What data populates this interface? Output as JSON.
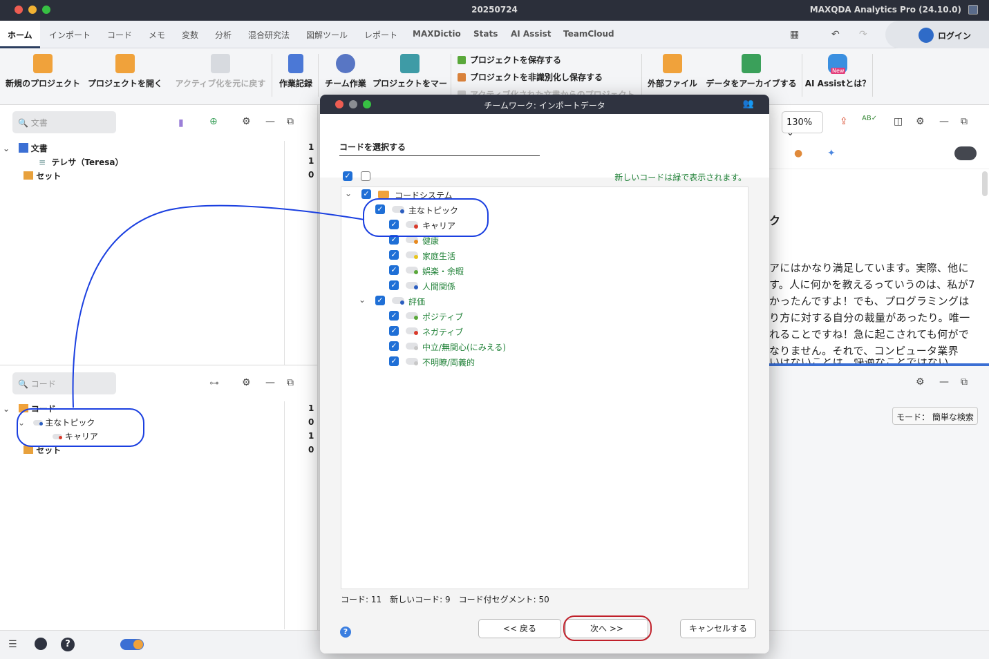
{
  "window": {
    "title": "20250724",
    "app_name": "MAXQDA Analytics Pro (24.10.0)"
  },
  "menu_tabs": [
    "ホーム",
    "インポート",
    "コード",
    "メモ",
    "変数",
    "分析",
    "混合研究法",
    "図解ツール",
    "レポート",
    "MAXDictio",
    "Stats",
    "AI Assist",
    "TeamCloud"
  ],
  "login_label": "ログイン",
  "ribbon": {
    "new_project": "新規のプロジェクト",
    "open_project": "プロジェクトを開く",
    "undo_activation": "アクティブ化を元に戻す",
    "work_log": "作業記録",
    "teamwork": "チーム作業",
    "merge_project": "プロジェクトをマー",
    "save_project": "プロジェクトを保存する",
    "save_anonymized": "プロジェクトを非識別化し保存する",
    "export_activated": "アクティブ化された文書からのプロジェクト",
    "external_files": "外部ファイル",
    "archive_data": "データをアーカイブする",
    "ai_assist": "AI Assistとは？",
    "new_badge": "New"
  },
  "doc_panel": {
    "search_placeholder": "文書",
    "rows": [
      {
        "label": "文書",
        "count": "1"
      },
      {
        "label": "テレサ（Teresa）",
        "count": "1"
      },
      {
        "label": "セット",
        "count": "0"
      }
    ]
  },
  "code_panel": {
    "search_placeholder": "コード",
    "rows": [
      {
        "label": "コード",
        "count": "1"
      },
      {
        "label": "主なトピック",
        "count": "0"
      },
      {
        "label": "キャリア",
        "count": "1"
      },
      {
        "label": "セット",
        "count": "0"
      }
    ]
  },
  "right_panel": {
    "zoom": "130%",
    "heading_fragment": "ク",
    "text_lines": [
      "アにはかなり満足しています。実際、他に",
      "す。人に何かを教えるっていうのは、私が7",
      "かったんですよ！でも、プログラミングは",
      "り方に対する自分の裁量があったり。唯一",
      "れることですね！急に起こされても何がで",
      "なりません。それで、コンピュータ業界",
      "いけないことは、快適なことではない"
    ],
    "mode_label": "モード： 簡単な検索"
  },
  "dialog": {
    "title": "チームワーク: インポートデータ",
    "section_title": "コードを選択する",
    "info_green": "新しいコードは緑で表示されます。",
    "tree": [
      {
        "label": "コードシステム",
        "level": 0,
        "green": false,
        "dot": ""
      },
      {
        "label": "主なトピック",
        "level": 1,
        "green": false,
        "dot": "#2b5ec0"
      },
      {
        "label": "キャリア",
        "level": 2,
        "green": false,
        "dot": "#d93a2b"
      },
      {
        "label": "健康",
        "level": 2,
        "green": true,
        "dot": "#e8891d"
      },
      {
        "label": "家庭生活",
        "level": 2,
        "green": true,
        "dot": "#e8c51d"
      },
      {
        "label": "娯楽・余暇",
        "level": 2,
        "green": true,
        "dot": "#5aa83a"
      },
      {
        "label": "人間関係",
        "level": 2,
        "green": true,
        "dot": "#2b5ec0"
      },
      {
        "label": "評価",
        "level": 1,
        "green": true,
        "dot": "#2b5ec0"
      },
      {
        "label": "ポジティブ",
        "level": 2,
        "green": true,
        "dot": "#5aa83a"
      },
      {
        "label": "ネガティブ",
        "level": 2,
        "green": true,
        "dot": "#d93a2b"
      },
      {
        "label": "中立/無関心(にみえる)",
        "level": 2,
        "green": true,
        "dot": "#c8c8c8"
      },
      {
        "label": "不明瞭/両義的",
        "level": 2,
        "green": true,
        "dot": "#c8c8c8"
      }
    ],
    "stats": "コード: 11　新しいコード: 9　コード付セグメント: 50",
    "back_button": "<< 戻る",
    "next_button": "次へ >>",
    "cancel_button": "キャンセルする"
  },
  "colors": {
    "accent": "#1f6fd6",
    "new_code_green": "#23833a",
    "annotation_blue": "#1a3fe0",
    "annotation_red": "#c0202a"
  }
}
